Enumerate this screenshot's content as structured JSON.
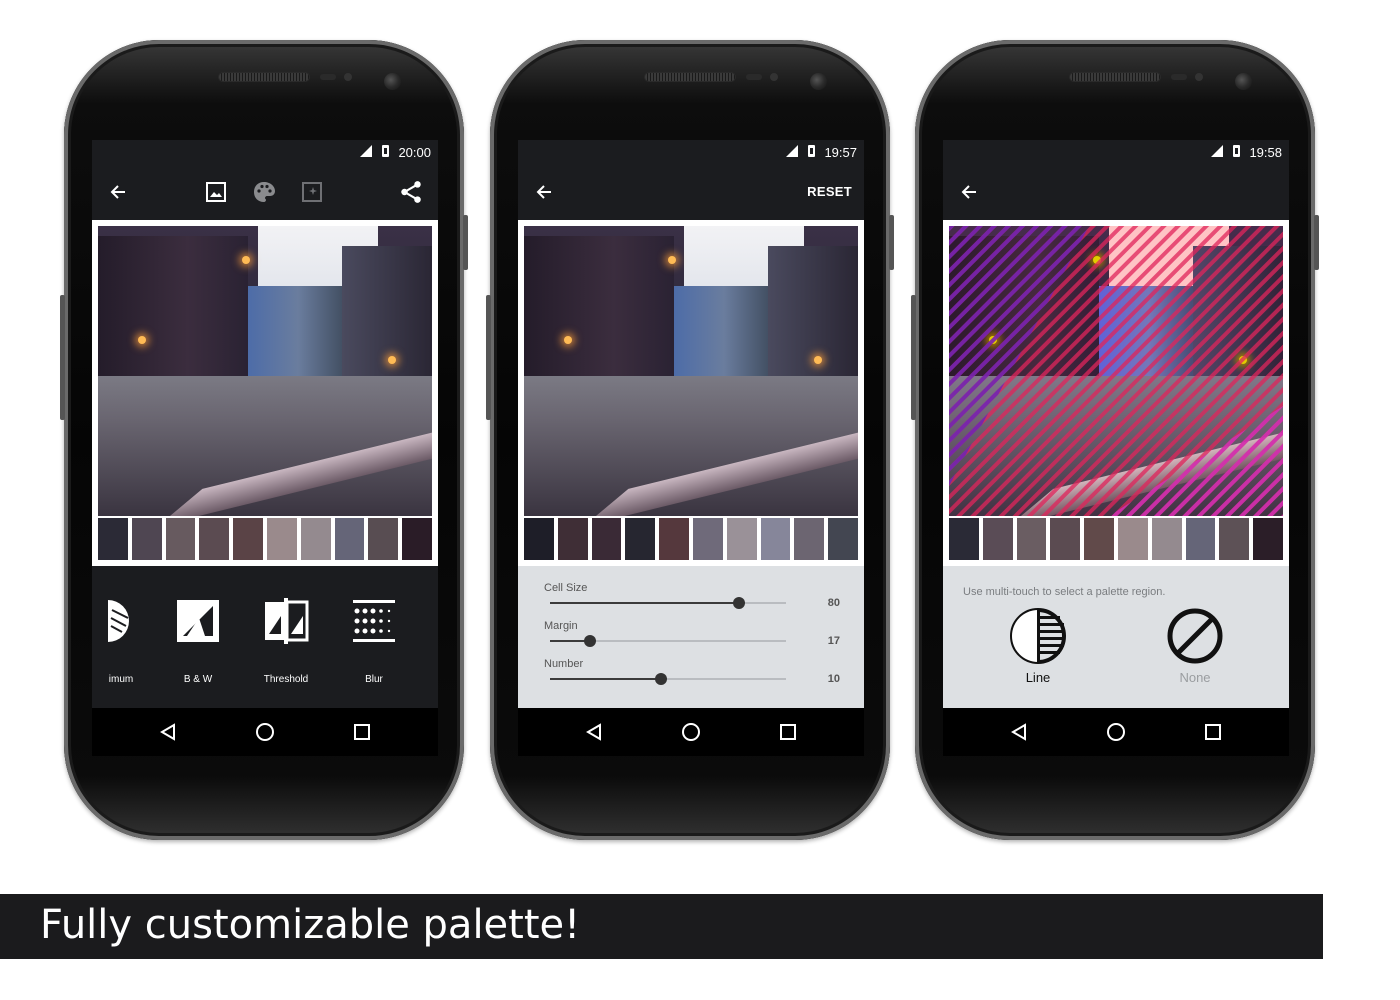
{
  "phones": [
    {
      "status_time": "20:00",
      "toolbar": {
        "back_icon": "arrow-left-icon",
        "tab_icons": [
          "image-icon",
          "palette-icon",
          "effects-icon"
        ],
        "share_icon": "share-icon"
      },
      "palette_colors": [
        "#2b2a36",
        "#4f4652",
        "#675a5f",
        "#5b4b51",
        "#5a4346",
        "#9a8a8c",
        "#948a8f",
        "#656578",
        "#584d52",
        "#2a1c27"
      ],
      "filters": [
        {
          "label": "imum",
          "icon": "minimum-icon"
        },
        {
          "label": "B & W",
          "icon": "black-white-icon"
        },
        {
          "label": "Threshold",
          "icon": "threshold-icon"
        },
        {
          "label": "Blur",
          "icon": "blur-icon"
        }
      ]
    },
    {
      "status_time": "19:57",
      "toolbar": {
        "back_icon": "arrow-left-icon",
        "reset_label": "RESET"
      },
      "palette_colors": [
        "#1e1e28",
        "#3f2e36",
        "#3a2a36",
        "#262630",
        "#55383d",
        "#6f6a7a",
        "#9a9198",
        "#86869a",
        "#6c6571",
        "#434651"
      ],
      "sliders": [
        {
          "label": "Cell Size",
          "value": "80",
          "fraction": 0.8
        },
        {
          "label": "Margin",
          "value": "17",
          "fraction": 0.17
        },
        {
          "label": "Number",
          "value": "10",
          "fraction": 0.47
        }
      ]
    },
    {
      "status_time": "19:58",
      "toolbar": {
        "back_icon": "arrow-left-icon"
      },
      "palette_colors": [
        "#2a2a36",
        "#5a4c56",
        "#6a5d62",
        "#5b4b51",
        "#614a4a",
        "#9a8a8c",
        "#948a8f",
        "#656578",
        "#5d5156",
        "#2b1e28"
      ],
      "hint": "Use multi-touch to select a palette region.",
      "options": [
        {
          "label": "Line",
          "icon": "line-pattern-icon",
          "selected": true
        },
        {
          "label": "None",
          "icon": "none-icon",
          "selected": false
        }
      ]
    }
  ],
  "caption": "Fully customizable palette!"
}
